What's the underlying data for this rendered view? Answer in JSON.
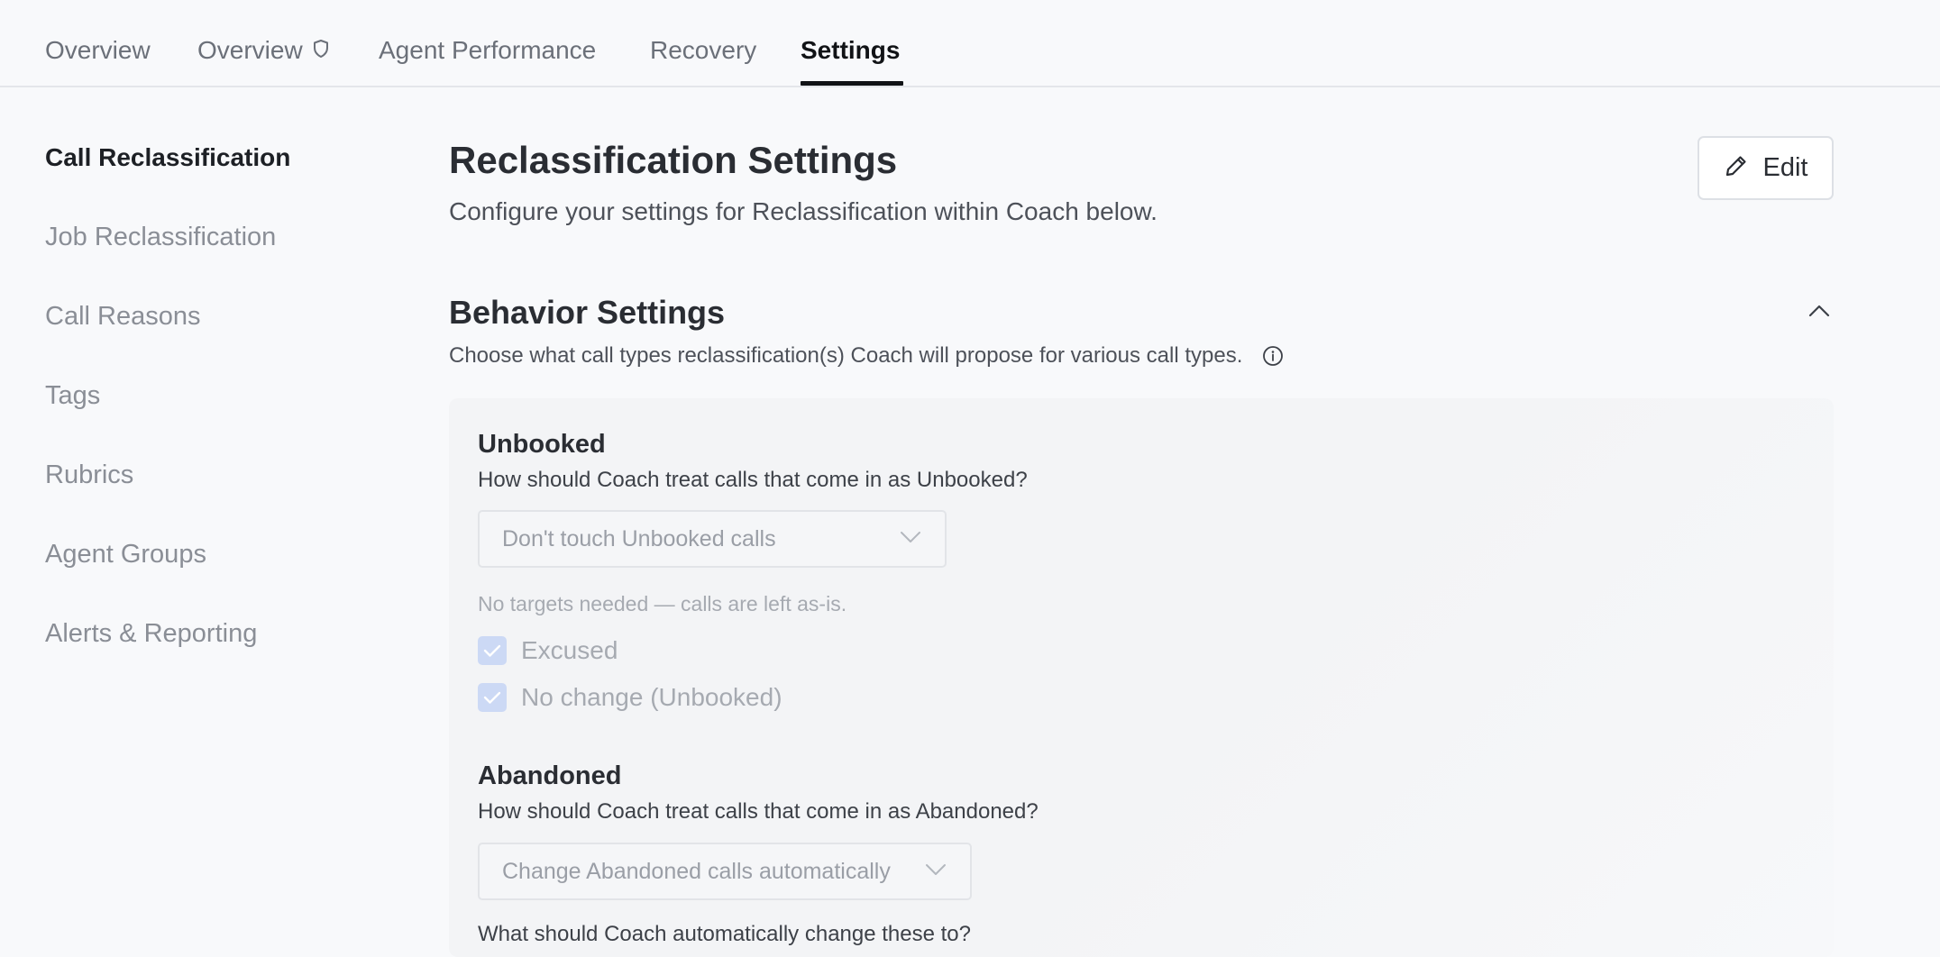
{
  "tabs": [
    {
      "label": "Overview"
    },
    {
      "label": "Overview"
    },
    {
      "label": "Agent Performance"
    },
    {
      "label": "Recovery"
    },
    {
      "label": "Settings"
    }
  ],
  "sidebar": {
    "items": [
      {
        "label": "Call Reclassification"
      },
      {
        "label": "Job Reclassification"
      },
      {
        "label": "Call Reasons"
      },
      {
        "label": "Tags"
      },
      {
        "label": "Rubrics"
      },
      {
        "label": "Agent Groups"
      },
      {
        "label": "Alerts & Reporting"
      }
    ]
  },
  "main": {
    "title": "Reclassification Settings",
    "subtitle": "Configure your settings for Reclassification within Coach below.",
    "edit_label": "Edit",
    "section": {
      "title": "Behavior Settings",
      "subtitle": "Choose what call types reclassification(s) Coach will propose for various call types."
    },
    "groups": [
      {
        "title": "Unbooked",
        "question": "How should Coach treat calls that come in as Unbooked?",
        "select_value": "Don't touch Unbooked calls",
        "hint": "No targets needed — calls are left as-is.",
        "checkboxes": [
          {
            "label": "Excused",
            "checked": true
          },
          {
            "label": "No change (Unbooked)",
            "checked": true
          }
        ]
      },
      {
        "title": "Abandoned",
        "question": "How should Coach treat calls that come in as Abandoned?",
        "select_value": "Change Abandoned calls automatically",
        "followup": "What should Coach automatically change these to?"
      }
    ]
  },
  "colors": {
    "background": "#f8f9fb",
    "active_tab": "#111316",
    "inactive_text": "#8a8e96",
    "checkbox_fill": "#ccd9f5"
  }
}
